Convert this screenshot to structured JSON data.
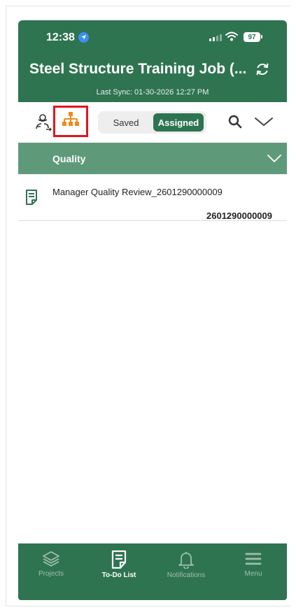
{
  "status_bar": {
    "time": "12:38",
    "battery": "97"
  },
  "header": {
    "title": "Steel Structure Training Job (...",
    "last_sync": "Last Sync: 01-30-2026 12:27 PM"
  },
  "toolbar": {
    "segment_saved": "Saved",
    "segment_assigned": "Assigned",
    "selected_segment": "Assigned"
  },
  "group": {
    "label": "Quality"
  },
  "items": [
    {
      "title": "Manager Quality Review_2601290000009",
      "number": "2601290000009"
    }
  ],
  "tabbar": {
    "tabs": [
      {
        "label": "Projects",
        "icon": "layers-icon"
      },
      {
        "label": "To-Do List",
        "icon": "document-icon"
      },
      {
        "label": "Notifications",
        "icon": "bell-icon"
      },
      {
        "label": "Menu",
        "icon": "menu-icon"
      }
    ],
    "active": "To-Do List"
  },
  "colors": {
    "primary_green": "#2f7451",
    "group_green": "#5e9a7a",
    "org_icon_orange": "#f28a1a",
    "highlight_red": "#e0161f"
  }
}
